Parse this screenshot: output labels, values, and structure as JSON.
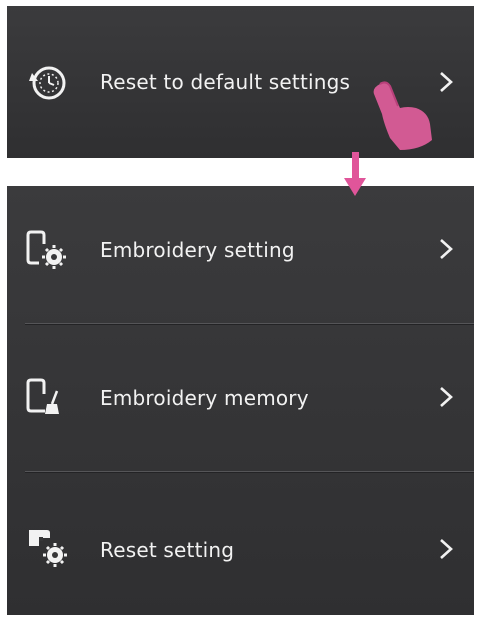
{
  "reset_default": {
    "label": "Reset to default settings",
    "icon": "reset-clock-icon"
  },
  "menu": {
    "items": [
      {
        "label": "Embroidery setting",
        "icon": "embroidery-hoop-gear-icon"
      },
      {
        "label": "Embroidery memory",
        "icon": "embroidery-hoop-broom-icon"
      },
      {
        "label": "Reset setting",
        "icon": "sewing-machine-gear-icon"
      }
    ]
  },
  "chevron_icon": "chevron-right-icon",
  "colors": {
    "panel_bg": "#363638",
    "text": "#f2f2f2",
    "annotation_pink": "#e0559a"
  }
}
